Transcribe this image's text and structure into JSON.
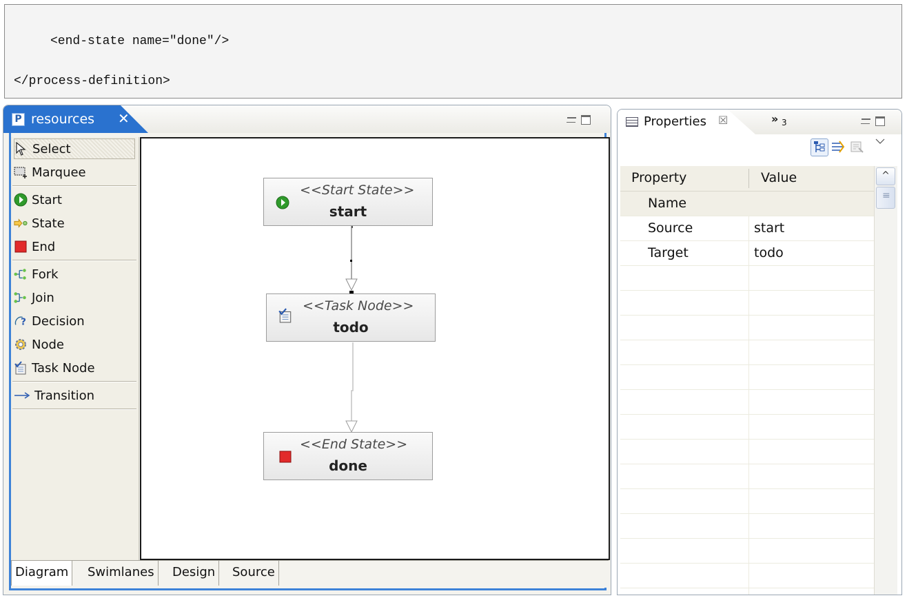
{
  "code": {
    "line1": "<end-state name=\"done\"/>",
    "line2": "</process-definition>"
  },
  "editor": {
    "tab_title": "resources",
    "tab_icon_letter": "P",
    "close_glyph": "✕",
    "palette": {
      "items": [
        {
          "label": "Select",
          "icon": "select-arrow-icon"
        },
        {
          "label": "Marquee",
          "icon": "marquee-icon"
        },
        {
          "label": "Start",
          "icon": "start-state-icon"
        },
        {
          "label": "State",
          "icon": "state-icon"
        },
        {
          "label": "End",
          "icon": "end-state-icon"
        },
        {
          "label": "Fork",
          "icon": "fork-icon"
        },
        {
          "label": "Join",
          "icon": "join-icon"
        },
        {
          "label": "Decision",
          "icon": "decision-icon"
        },
        {
          "label": "Node",
          "icon": "node-gear-icon"
        },
        {
          "label": "Task Node",
          "icon": "task-node-icon"
        },
        {
          "label": "Transition",
          "icon": "transition-arrow-icon"
        }
      ],
      "selected": "Select"
    },
    "diagram": {
      "nodes": [
        {
          "stereotype": "<<Start State>>",
          "name": "start",
          "icon": "start-state-icon"
        },
        {
          "stereotype": "<<Task Node>>",
          "name": "todo",
          "icon": "task-node-icon"
        },
        {
          "stereotype": "<<End State>>",
          "name": "done",
          "icon": "end-state-icon"
        }
      ]
    },
    "bottom_tabs": [
      "Diagram",
      "Swimlanes",
      "Design",
      "Source"
    ],
    "active_bottom_tab": "Diagram"
  },
  "properties": {
    "tab_title": "Properties",
    "close_glyph": "☒",
    "overflow_chevron": "»",
    "overflow_count": "3",
    "columns": [
      "Property",
      "Value"
    ],
    "rows": [
      {
        "property": "Name",
        "value": ""
      },
      {
        "property": "Source",
        "value": "start"
      },
      {
        "property": "Target",
        "value": "todo"
      }
    ],
    "selected_row": "Name",
    "scroll_up_glyph": "^"
  },
  "colors": {
    "accent": "#2a72cf",
    "start_green": "#2f9a2b",
    "end_red": "#e22a2a"
  }
}
